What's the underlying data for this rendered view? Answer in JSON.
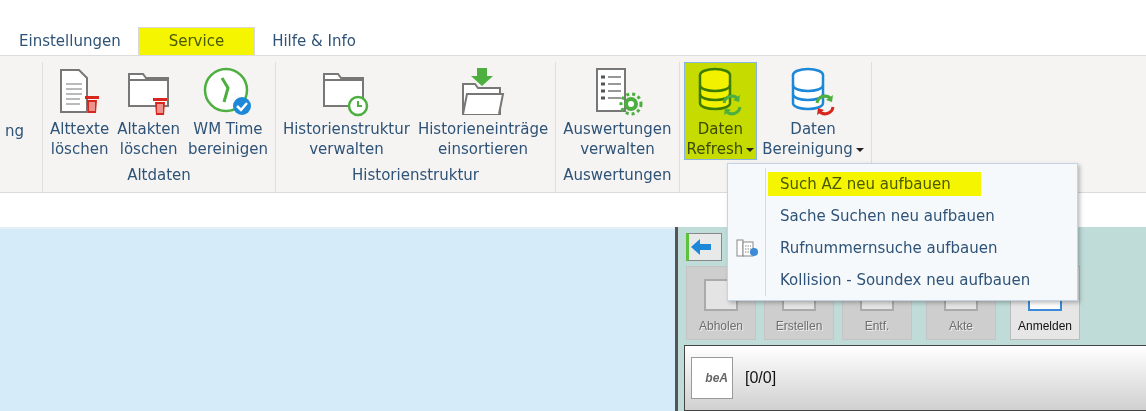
{
  "tabs": [
    {
      "label": "Einstellungen",
      "selected": false
    },
    {
      "label": "Service",
      "selected": true
    },
    {
      "label": "Hilfe & Info",
      "selected": false
    }
  ],
  "ribbon": {
    "groups": [
      {
        "buttons": [
          {
            "lines": [
              "ng"
            ],
            "dropdown": false,
            "pressed": false
          }
        ]
      },
      {
        "label": "Altdaten",
        "buttons": [
          {
            "lines": [
              "Alttexte",
              "löschen"
            ],
            "dropdown": false,
            "pressed": false
          },
          {
            "lines": [
              "Altakten",
              "löschen"
            ],
            "dropdown": false,
            "pressed": false
          },
          {
            "lines": [
              "WM Time",
              "bereinigen"
            ],
            "dropdown": false,
            "pressed": false
          }
        ]
      },
      {
        "label": "Historienstruktur",
        "buttons": [
          {
            "lines": [
              "Historienstruktur",
              "verwalten"
            ],
            "dropdown": false,
            "pressed": false
          },
          {
            "lines": [
              "Historieneinträge",
              "einsortieren"
            ],
            "dropdown": false,
            "pressed": false
          }
        ]
      },
      {
        "label": "Auswertungen",
        "buttons": [
          {
            "lines": [
              "Auswertungen",
              "verwalten"
            ],
            "dropdown": false,
            "pressed": false
          }
        ]
      },
      {
        "buttons": [
          {
            "lines": [
              "Daten",
              "Refresh"
            ],
            "dropdown": true,
            "pressed": true
          },
          {
            "lines": [
              "Daten",
              "Bereinigung"
            ],
            "dropdown": true,
            "pressed": false
          }
        ]
      }
    ]
  },
  "menu": {
    "items": [
      {
        "label": "Such AZ neu aufbauen",
        "selected": true,
        "has_icon": false
      },
      {
        "label": "Sache Suchen neu aufbauen",
        "selected": false,
        "has_icon": false
      },
      {
        "label": "Rufnummernsuche aufbauen",
        "selected": false,
        "has_icon": true
      },
      {
        "label": "Kollision - Soundex neu aufbauen",
        "selected": false,
        "has_icon": false
      }
    ]
  },
  "panel": {
    "toolbar": [
      {
        "label": "Abholen",
        "disabled": true
      },
      {
        "label": "Erstellen",
        "disabled": true
      },
      {
        "label": "Entf.",
        "disabled": true
      },
      {
        "label": "Akte",
        "disabled": true
      },
      {
        "label": "Anmelden",
        "disabled": false
      }
    ],
    "bea": {
      "logo_text": "beA",
      "count": "[0/0]"
    }
  }
}
